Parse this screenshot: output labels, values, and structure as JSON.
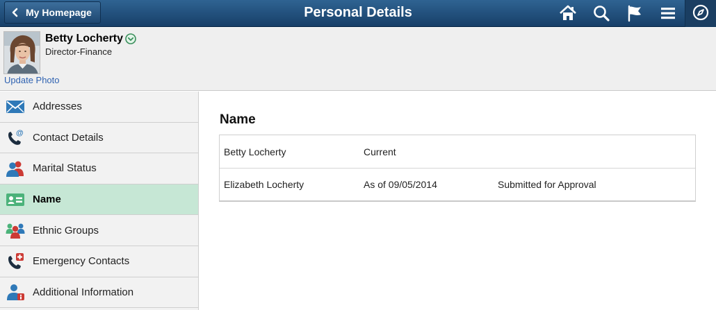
{
  "banner": {
    "back_label": "My Homepage",
    "title": "Personal Details",
    "icons": [
      "home-icon",
      "search-icon",
      "flag-icon",
      "menu-icon",
      "navbar-compass-icon"
    ]
  },
  "employee": {
    "name": "Betty Locherty",
    "job_title": "Director-Finance",
    "update_photo_label": "Update Photo"
  },
  "sidebar": {
    "items": [
      {
        "label": "Addresses",
        "icon": "envelope-icon"
      },
      {
        "label": "Contact Details",
        "icon": "phone-at-icon"
      },
      {
        "label": "Marital Status",
        "icon": "couple-icon"
      },
      {
        "label": "Name",
        "icon": "id-card-icon",
        "selected": true
      },
      {
        "label": "Ethnic Groups",
        "icon": "group-icon"
      },
      {
        "label": "Emergency Contacts",
        "icon": "emergency-phone-icon"
      },
      {
        "label": "Additional Information",
        "icon": "person-info-icon"
      }
    ]
  },
  "main": {
    "section_title": "Name",
    "rows": [
      {
        "name": "Betty Locherty",
        "date": "Current",
        "status": ""
      },
      {
        "name": "Elizabeth Locherty",
        "date": "As of 09/05/2014",
        "status": "Submitted for Approval"
      }
    ]
  },
  "colors": {
    "banner_top": "#2f6392",
    "banner_bottom": "#173f68",
    "selected_item": "#c6e7d5",
    "link": "#2f62b1",
    "icon_blue": "#2f79b8",
    "icon_green": "#4bb27a",
    "icon_red": "#cc3b35"
  }
}
